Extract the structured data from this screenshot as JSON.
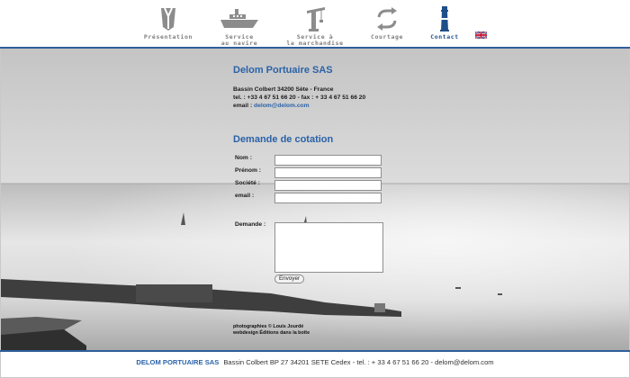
{
  "nav": {
    "items": [
      {
        "label": "Présentation",
        "icon": "hull-icon"
      },
      {
        "label": "Service\nau navire",
        "icon": "ship-icon"
      },
      {
        "label": "Service à\nla marchandise",
        "icon": "crane-icon"
      },
      {
        "label": "Courtage",
        "icon": "exchange-arrows-icon"
      },
      {
        "label": "Contact",
        "icon": "lighthouse-icon",
        "active": true
      }
    ],
    "language_flag": "uk-flag-icon"
  },
  "contact": {
    "company": "Delom Portuaire SAS",
    "address": "Bassin Colbert 34200 Sète - France",
    "phones": "tel. : +33 4 67 51 66 20 - fax : + 33 4 67 51 66 20",
    "email_label": "email : ",
    "email": "delom@delom.com"
  },
  "form": {
    "title": "Demande de cotation",
    "nom_label": "Nom :",
    "prenom_label": "Prénom :",
    "societe_label": "Société :",
    "email_label": "email :",
    "demande_label": "Demande :",
    "submit_label": "Envoyer"
  },
  "credits": {
    "line1": "photographies © Louis Jourdé",
    "line2": "webdesign Éditions dans la boîte"
  },
  "footer": {
    "company": "DELOM PORTUAIRE SAS",
    "details": "Bassin Colbert BP 27 34201 SETE Cedex - tel. : + 33 4 67 51 66 20 - delom@delom.com"
  },
  "colors": {
    "accent": "#2a62a8",
    "nav_line": "#2f5f9a",
    "nav_icon_grey": "#8c8c8c",
    "nav_icon_active": "#1f4f8a"
  }
}
